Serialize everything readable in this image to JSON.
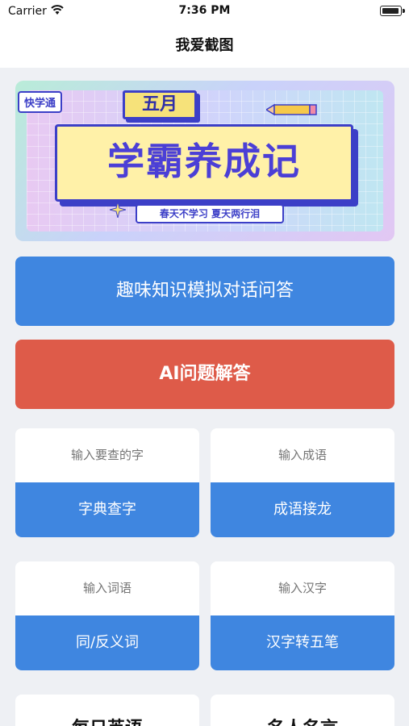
{
  "status_bar": {
    "carrier": "Carrier",
    "time": "7:36 PM"
  },
  "nav": {
    "title": "我爱截图"
  },
  "banner": {
    "brand": "快学通",
    "month": "五月",
    "title": "学霸养成记",
    "subtitle": "春天不学习  夏天两行泪"
  },
  "buttons": {
    "qa_label": "趣味知识模拟对话问答",
    "ai_label": "AI问题解答"
  },
  "tools": [
    {
      "placeholder": "输入要查的字",
      "action": "字典查字"
    },
    {
      "placeholder": "输入成语",
      "action": "成语接龙"
    },
    {
      "placeholder": "输入词语",
      "action": "同/反义词"
    },
    {
      "placeholder": "输入汉字",
      "action": "汉字转五笔"
    }
  ],
  "bottom_cards": [
    {
      "label": "每日英语"
    },
    {
      "label": "名人名言"
    }
  ],
  "colors": {
    "primary_blue": "#3f86e0",
    "accent_red": "#de5b49",
    "background": "#eef0f4"
  }
}
